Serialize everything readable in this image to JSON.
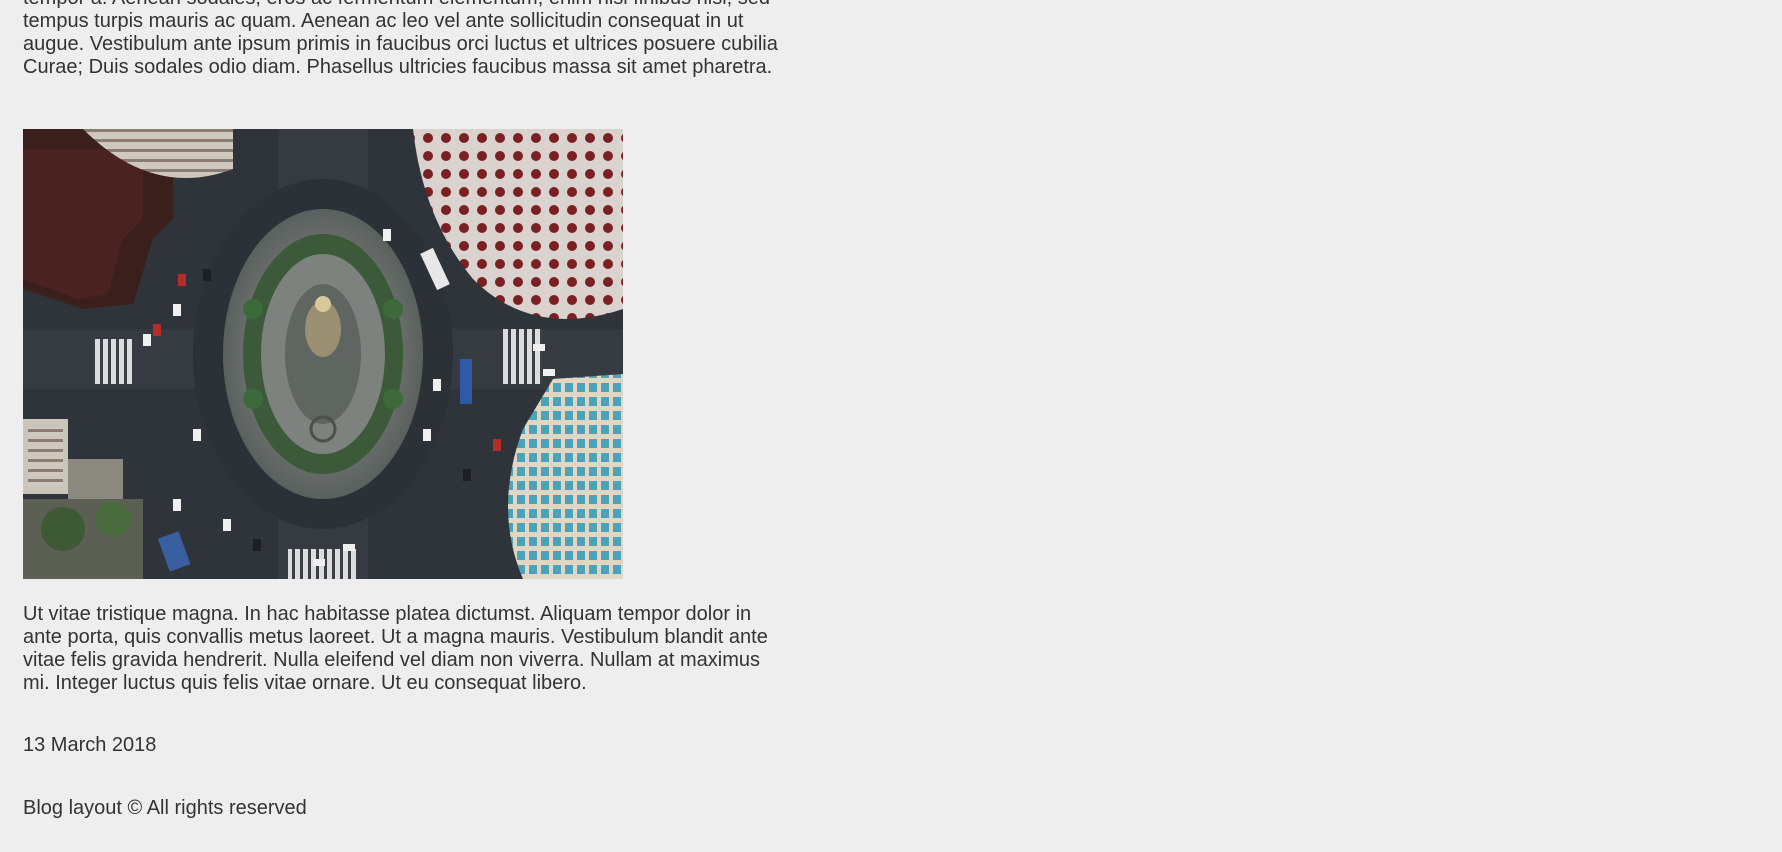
{
  "article": {
    "paragraph_top": "tempor a. Aenean sodales, eros ac fermentum elementum, enim nisi finibus nisi, sed tempus turpis mauris ac quam. Aenean ac leo vel ante sollicitudin consequat in ut augue. Vestibulum ante ipsum primis in faucibus orci luctus et ultrices posuere cubilia Curae; Duis sodales odio diam. Phasellus ultricies faucibus massa sit amet pharetra.",
    "paragraph_bottom": "Ut vitae tristique magna. In hac habitasse platea dictumst. Aliquam tempor dolor in ante porta, quis convallis metus laoreet. Ut a magna mauris. Vestibulum blandit ante vitae felis gravida hendrerit. Nulla eleifend vel diam non viverra. Nullam at maximus mi. Integer luctus quis felis vitae ornare. Ut eu consequat libero.",
    "date": "13 March 2018"
  },
  "footer": {
    "text": "Blog layout © All rights reserved"
  },
  "colors": {
    "background": "#eeeeee",
    "text": "#333333"
  }
}
